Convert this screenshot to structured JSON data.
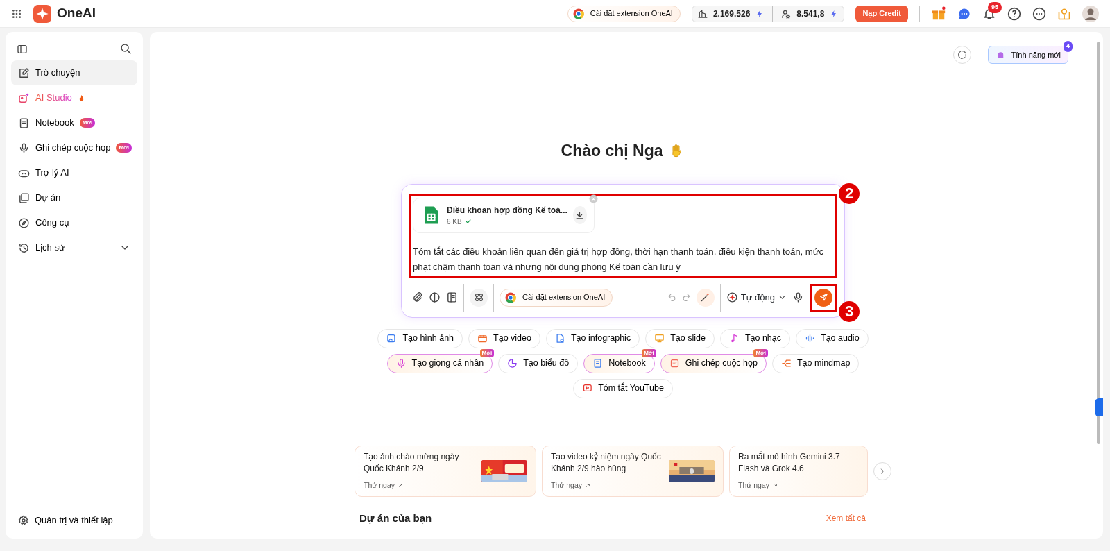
{
  "topbar": {
    "brand": "OneAI",
    "extension_button": "Cài đặt extension OneAI",
    "credits": [
      {
        "value": "2.169.526"
      },
      {
        "value": "8.541,8"
      }
    ],
    "topup_button": "Nạp Credit",
    "notification_count": "95"
  },
  "sidebar": {
    "items": [
      {
        "label": "Trò chuyện",
        "selected": true,
        "kind": "plain"
      },
      {
        "label": "AI Studio",
        "selected": false,
        "kind": "studio"
      },
      {
        "label": "Notebook",
        "selected": false,
        "kind": "plain",
        "badge": "Mới"
      },
      {
        "label": "Ghi chép cuộc họp",
        "selected": false,
        "kind": "plain",
        "badge": "Mới"
      },
      {
        "label": "Trợ lý AI",
        "selected": false,
        "kind": "plain"
      },
      {
        "label": "Dự án",
        "selected": false,
        "kind": "plain"
      },
      {
        "label": "Công cụ",
        "selected": false,
        "kind": "plain"
      },
      {
        "label": "Lịch sử",
        "selected": false,
        "kind": "expandable",
        "expanded": false
      }
    ],
    "footer": "Quản trị và thiết lập"
  },
  "main": {
    "whats_new": {
      "label": "Tính năng mới",
      "count": "4"
    },
    "greeting": "Chào chị Nga",
    "composer": {
      "attachment": {
        "name": "Điều khoản hợp đồng Kế toá...",
        "size": "6 KB",
        "uploaded": true
      },
      "prompt": "Tóm tắt các điều khoản liên quan đến giá trị hợp đồng, thời hạn thanh toán, điều kiện thanh toán, mức phạt chậm thanh toán và những nội dung phòng Kế toán cần lưu ý",
      "extension_button": "Cài đặt extension OneAI",
      "mode": "Tự động",
      "annotations": [
        {
          "label": "2"
        },
        {
          "label": "3"
        }
      ]
    },
    "chips": [
      {
        "label": "Tạo hình ảnh"
      },
      {
        "label": "Tạo video"
      },
      {
        "label": "Tạo infographic"
      },
      {
        "label": "Tạo slide"
      },
      {
        "label": "Tạo nhạc"
      },
      {
        "label": "Tạo audio"
      },
      {
        "label": "Tạo giọng cá nhân",
        "badge": "Mới"
      },
      {
        "label": "Tạo biểu đồ"
      },
      {
        "label": "Notebook",
        "badge": "Mới"
      },
      {
        "label": "Ghi chép cuộc họp",
        "badge": "Mới"
      },
      {
        "label": "Tạo mindmap"
      },
      {
        "label": "Tóm tắt YouTube"
      }
    ],
    "cards": [
      {
        "title": "Tạo ảnh chào mừng ngày Quốc Khánh 2/9",
        "action": "Thử ngay",
        "kind": "picture"
      },
      {
        "title": "Tạo video kỷ niệm ngày Quốc Khánh 2/9 hào hùng",
        "action": "Thử ngay",
        "kind": "picture"
      },
      {
        "title": "Ra mắt mô hình Gemini 3.7 Flash và Grok 4.6",
        "action": "Thử ngay",
        "kind": "text"
      }
    ],
    "projects": {
      "title": "Dự án của bạn",
      "see_all": "Xem tất cả"
    }
  }
}
